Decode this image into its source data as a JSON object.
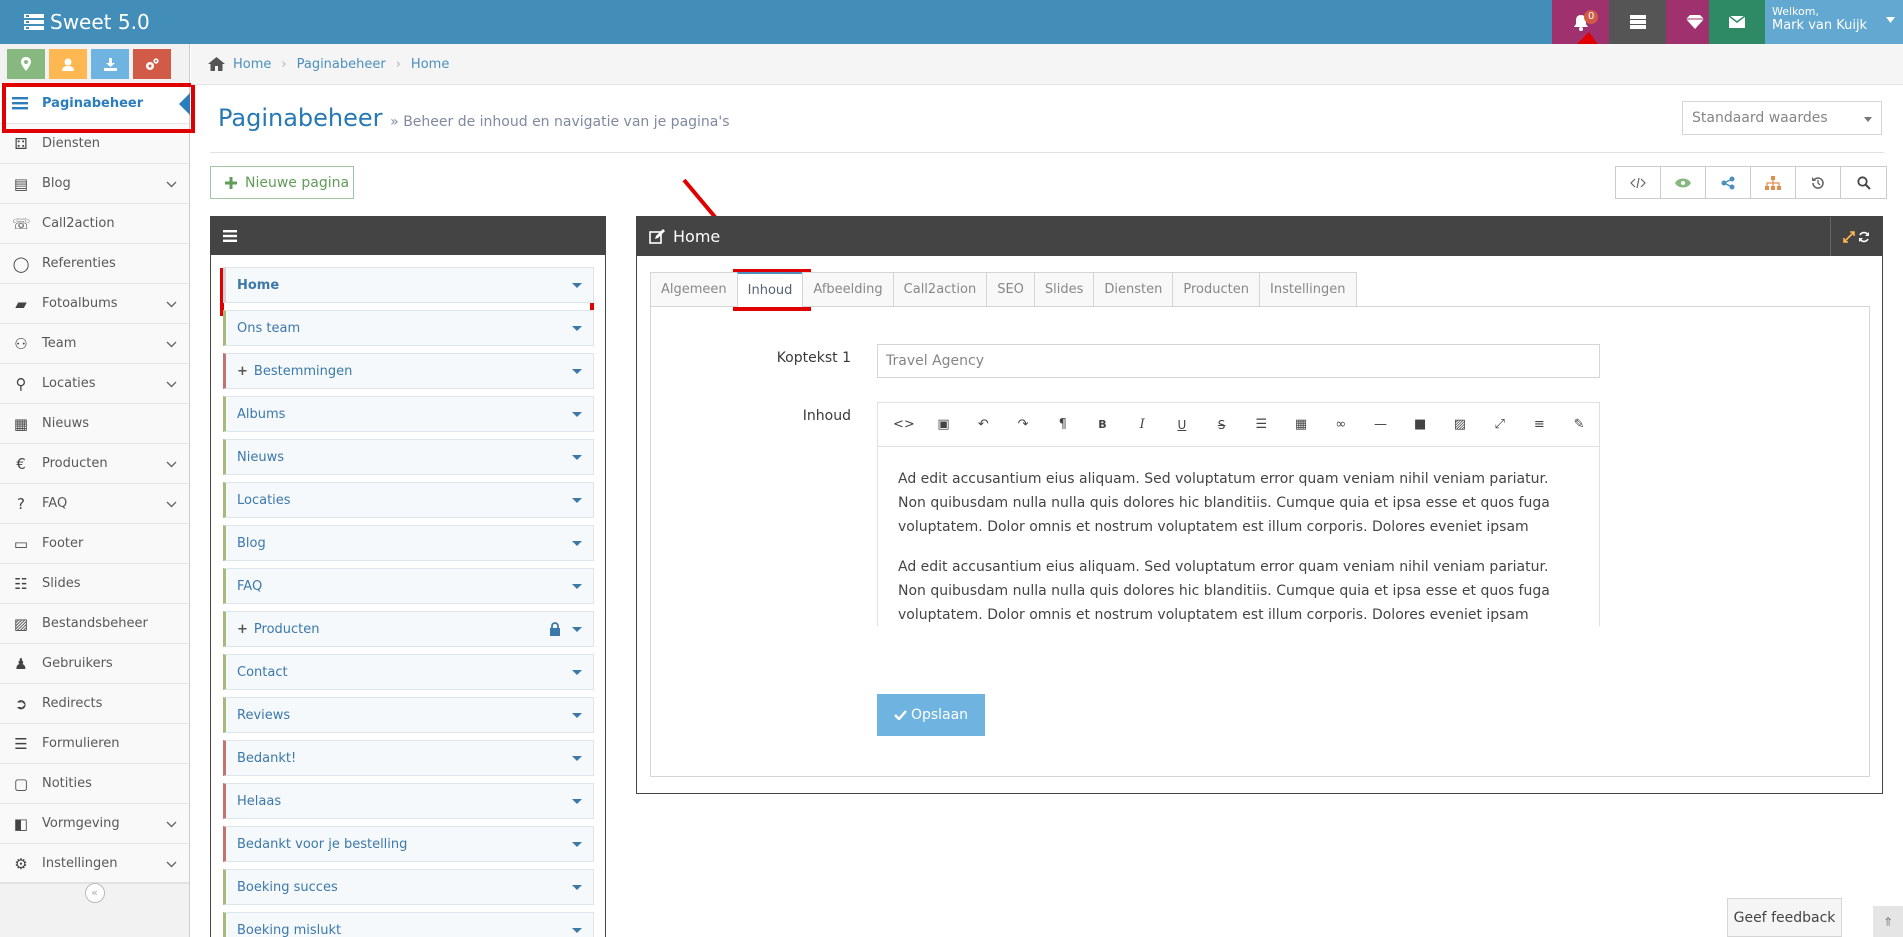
{
  "app": {
    "title": "Sweet 5.0"
  },
  "topbar": {
    "notification_count": "0",
    "welcome": "Welkom,",
    "user_name": "Mark van Kuijk"
  },
  "colors": {
    "brand": "#438eb9",
    "shortcut_green": "#87b87f",
    "shortcut_orange": "#ffb752",
    "shortcut_blue": "#6fb3e0",
    "shortcut_red": "#d15b47",
    "bell_bg": "#a0316f",
    "server_bg": "#555555",
    "diamond_bg": "#a0316f",
    "mail_bg": "#2e8965",
    "highlight": "#e00000"
  },
  "sidebar": {
    "items": [
      {
        "label": "Paginabeheer",
        "icon": "menu-icon",
        "chevron": false
      },
      {
        "label": "Diensten",
        "icon": "cubes-icon",
        "chevron": false
      },
      {
        "label": "Blog",
        "icon": "file-icon",
        "chevron": true
      },
      {
        "label": "Call2action",
        "icon": "phone-icon",
        "chevron": false
      },
      {
        "label": "Referenties",
        "icon": "comment-icon",
        "chevron": false
      },
      {
        "label": "Fotoalbums",
        "icon": "book-icon",
        "chevron": true
      },
      {
        "label": "Team",
        "icon": "users-icon",
        "chevron": true
      },
      {
        "label": "Locaties",
        "icon": "map-marker-icon",
        "chevron": true
      },
      {
        "label": "Nieuws",
        "icon": "newspaper-icon",
        "chevron": false
      },
      {
        "label": "Producten",
        "icon": "euro-icon",
        "chevron": true
      },
      {
        "label": "FAQ",
        "icon": "question-icon",
        "chevron": true
      },
      {
        "label": "Footer",
        "icon": "footer-icon",
        "chevron": false
      },
      {
        "label": "Slides",
        "icon": "sliders-icon",
        "chevron": false
      },
      {
        "label": "Bestandsbeheer",
        "icon": "image-icon",
        "chevron": false
      },
      {
        "label": "Gebruikers",
        "icon": "user-icon",
        "chevron": false
      },
      {
        "label": "Redirects",
        "icon": "redirect-icon",
        "chevron": false
      },
      {
        "label": "Formulieren",
        "icon": "form-icon",
        "chevron": false
      },
      {
        "label": "Notities",
        "icon": "note-icon",
        "chevron": false
      },
      {
        "label": "Vormgeving",
        "icon": "layout-icon",
        "chevron": true
      },
      {
        "label": "Instellingen",
        "icon": "gear-icon",
        "chevron": true
      }
    ]
  },
  "breadcrumbs": [
    "Home",
    "Paginabeheer",
    "Home"
  ],
  "page": {
    "title": "Paginabeheer",
    "subtitle": "» Beheer de inhoud en navigatie van je pagina's"
  },
  "select": {
    "value": "Standaard waardes"
  },
  "new_page": {
    "label": "Nieuwe pagina"
  },
  "tree": [
    {
      "label": "Home",
      "plus": false,
      "lock": false,
      "color": "sel"
    },
    {
      "label": "Ons team",
      "plus": false,
      "lock": false,
      "color": "g"
    },
    {
      "label": "Bestemmingen",
      "plus": true,
      "lock": false,
      "color": "r"
    },
    {
      "label": "Albums",
      "plus": false,
      "lock": false,
      "color": "g"
    },
    {
      "label": "Nieuws",
      "plus": false,
      "lock": false,
      "color": "g"
    },
    {
      "label": "Locaties",
      "plus": false,
      "lock": false,
      "color": "g"
    },
    {
      "label": "Blog",
      "plus": false,
      "lock": false,
      "color": "g"
    },
    {
      "label": "FAQ",
      "plus": false,
      "lock": false,
      "color": "g"
    },
    {
      "label": "Producten",
      "plus": true,
      "lock": true,
      "color": "g"
    },
    {
      "label": "Contact",
      "plus": false,
      "lock": false,
      "color": "g"
    },
    {
      "label": "Reviews",
      "plus": false,
      "lock": false,
      "color": "g"
    },
    {
      "label": "Bedankt!",
      "plus": false,
      "lock": false,
      "color": "r"
    },
    {
      "label": "Helaas",
      "plus": false,
      "lock": false,
      "color": "r"
    },
    {
      "label": "Bedankt voor je bestelling",
      "plus": false,
      "lock": false,
      "color": "r"
    },
    {
      "label": "Boeking succes",
      "plus": false,
      "lock": false,
      "color": "g"
    },
    {
      "label": "Boeking mislukt",
      "plus": false,
      "lock": false,
      "color": "g"
    }
  ],
  "editor_panel": {
    "title": "Home",
    "tabs": [
      "Algemeen",
      "Inhoud",
      "Afbeelding",
      "Call2action",
      "SEO",
      "Slides",
      "Diensten",
      "Producten",
      "Instellingen"
    ],
    "active_tab": "Inhoud",
    "koptekst_label": "Koptekst 1",
    "koptekst_value": "Travel Agency",
    "inhoud_label": "Inhoud",
    "paragraphs": [
      "Ad edit accusantium eius aliquam. Sed voluptatum error quam veniam nihil veniam pariatur. Non quibusdam nulla nulla quis dolores hic blanditiis. Cumque quia et ipsa esse et quos fuga voluptatem. Dolor omnis et nostrum voluptatem est illum corporis. Dolores eveniet ipsam",
      "Ad edit accusantium eius aliquam. Sed voluptatum error quam veniam nihil veniam pariatur. Non quibusdam nulla nulla quis dolores hic blanditiis. Cumque quia et ipsa esse et quos fuga voluptatem. Dolor omnis et nostrum voluptatem est illum corporis. Dolores eveniet ipsam"
    ],
    "save_label": "Opslaan"
  },
  "feedback": {
    "label": "Geef feedback"
  }
}
